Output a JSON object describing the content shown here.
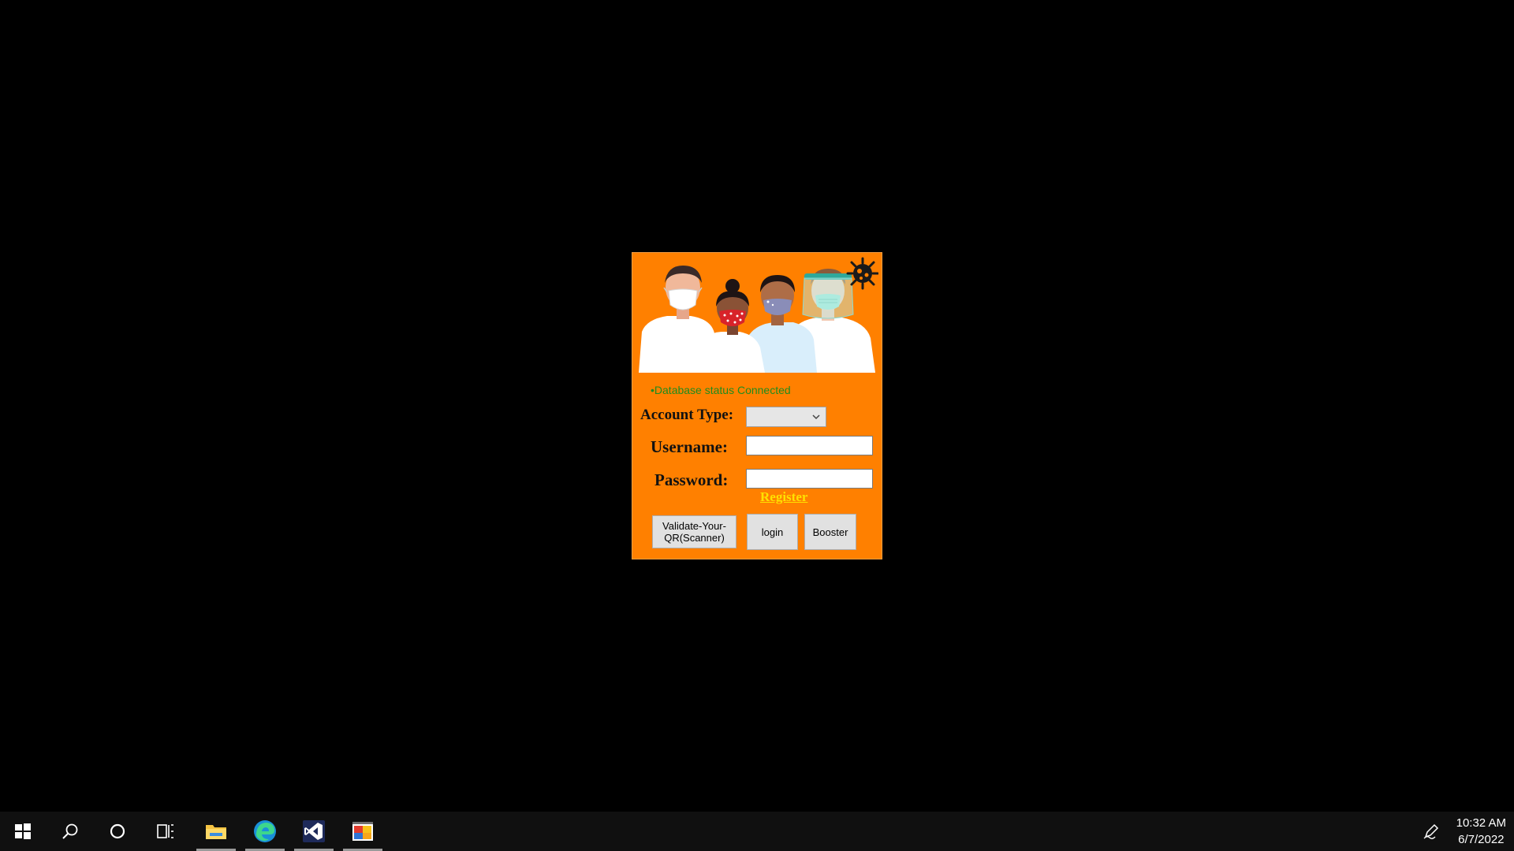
{
  "login": {
    "db_status": "•Database status Connected",
    "account_type_label": "Account Type:",
    "account_type_value": "",
    "username_label": "Username:",
    "username_value": "",
    "password_label": "Password:",
    "password_value": "",
    "register_link": "Register",
    "validate_button": "Validate-Your-QR(Scanner)",
    "login_button": "login",
    "booster_button": "Booster"
  },
  "taskbar": {
    "time": "10:32 AM",
    "date": "6/7/2022",
    "icons": [
      "windows-start-icon",
      "search-icon",
      "cortana-icon",
      "task-view-icon",
      "file-explorer-icon",
      "edge-browser-icon",
      "visual-studio-icon",
      "app-window-icon",
      "pen-icon"
    ]
  },
  "colors": {
    "window_background": "#FF8000",
    "status_green": "#1E8C1E",
    "register_yellow": "#FFE000",
    "taskbar": "#101010",
    "desktop": "#000000"
  }
}
